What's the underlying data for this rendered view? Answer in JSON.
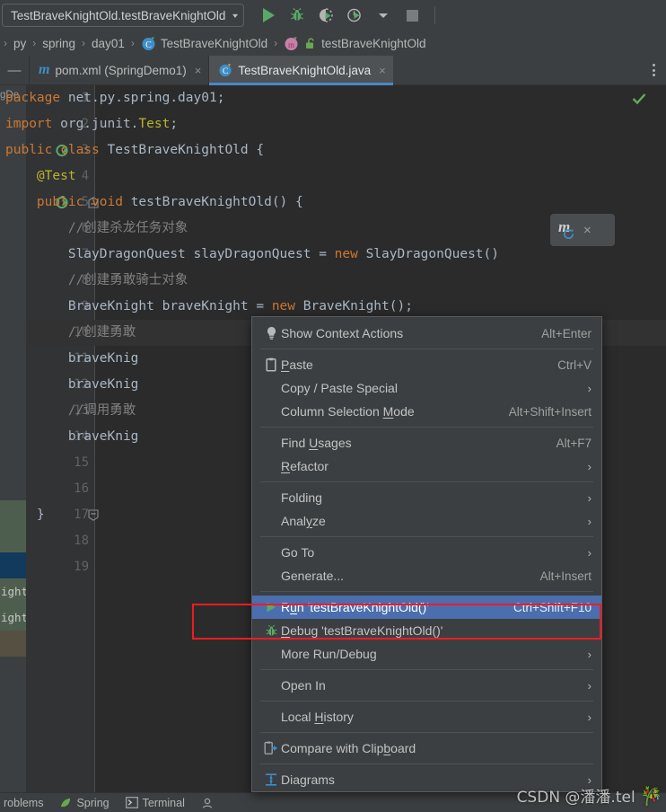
{
  "toolbar": {
    "run_config": "TestBraveKnightOld.testBraveKnightOld",
    "caret": "▾",
    "buttons": [
      {
        "name": "run-button",
        "label": "Run"
      },
      {
        "name": "debug-button",
        "label": "Debug"
      },
      {
        "name": "run-with-coverage-button",
        "label": "Run with Coverage"
      },
      {
        "name": "profiler-button",
        "label": "Profiler"
      },
      {
        "name": "profiler-dropdown",
        "label": "Profiler options"
      },
      {
        "name": "stop-button",
        "label": "Stop"
      }
    ]
  },
  "breadcrumb": {
    "separator": "›",
    "items": [
      {
        "label": "",
        "icon": "folder-icon"
      },
      {
        "label": "py",
        "icon": ""
      },
      {
        "label": "spring",
        "icon": ""
      },
      {
        "label": "day01",
        "icon": ""
      },
      {
        "label": "TestBraveKnightOld",
        "icon": "class-icon"
      },
      {
        "label": "testBraveKnightOld",
        "icon": "method-icon"
      }
    ]
  },
  "tabs": {
    "collapse_label": "—",
    "items": [
      {
        "label": "pom.xml (SpringDemo1)",
        "icon": "maven-icon",
        "active": false,
        "close": "×"
      },
      {
        "label": "TestBraveKnightOld.java",
        "icon": "java-class-icon",
        "active": true,
        "close": "×"
      }
    ],
    "overflow_label": "Tab options"
  },
  "editor": {
    "inspection_status": "✔",
    "maven_reload": {
      "label": "m",
      "close": "×"
    },
    "lines": [
      {
        "no": "1",
        "gutter": "",
        "fold": "",
        "tokens": [
          {
            "t": "package ",
            "c": "kw"
          },
          {
            "t": "net.py.spring.day01;",
            "c": "txt"
          }
        ]
      },
      {
        "no": "2",
        "gutter": "",
        "fold": "",
        "tokens": [
          {
            "t": "import ",
            "c": "kw"
          },
          {
            "t": "org.junit.",
            "c": "txt"
          },
          {
            "t": "Test",
            "c": "ann"
          },
          {
            "t": ";",
            "c": "txt"
          }
        ]
      },
      {
        "no": "3",
        "gutter": "run",
        "fold": "",
        "tokens": [
          {
            "t": "public class ",
            "c": "kw"
          },
          {
            "t": "TestBraveKnightOld {",
            "c": "txt"
          }
        ]
      },
      {
        "no": "4",
        "gutter": "",
        "fold": "",
        "tokens": [
          {
            "t": "    @Test",
            "c": "ann"
          }
        ]
      },
      {
        "no": "5",
        "gutter": "run",
        "fold": "minus",
        "tokens": [
          {
            "t": "    ",
            "c": "txt"
          },
          {
            "t": "public void ",
            "c": "kw"
          },
          {
            "t": "testBraveKnightOld() {",
            "c": "txt"
          }
        ]
      },
      {
        "no": "6",
        "gutter": "",
        "fold": "",
        "tokens": [
          {
            "t": "        //创建杀龙任务对象",
            "c": "cmt"
          }
        ]
      },
      {
        "no": "7",
        "gutter": "",
        "fold": "",
        "tokens": [
          {
            "t": "        SlayDragonQuest slayDragonQuest = ",
            "c": "txt"
          },
          {
            "t": "new ",
            "c": "kw"
          },
          {
            "t": "SlayDragonQuest()",
            "c": "txt"
          }
        ]
      },
      {
        "no": "8",
        "gutter": "",
        "fold": "",
        "tokens": [
          {
            "t": "        //创建勇敢骑士对象",
            "c": "cmt"
          }
        ]
      },
      {
        "no": "9",
        "gutter": "",
        "fold": "",
        "tokens": [
          {
            "t": "        BraveKnight braveKnight = ",
            "c": "txt"
          },
          {
            "t": "new ",
            "c": "kw"
          },
          {
            "t": "BraveKnight();",
            "c": "txt"
          }
        ]
      },
      {
        "no": "10",
        "gutter": "",
        "fold": "",
        "current": true,
        "tokens": [
          {
            "t": "        //创建勇敢",
            "c": "cmt"
          }
        ]
      },
      {
        "no": "11",
        "gutter": "",
        "fold": "",
        "tokens": [
          {
            "t": "        braveKnig",
            "c": "txt"
          }
        ]
      },
      {
        "no": "12",
        "gutter": "",
        "fold": "",
        "tokens": [
          {
            "t": "        braveKnig",
            "c": "txt"
          }
        ]
      },
      {
        "no": "13",
        "gutter": "",
        "fold": "",
        "tokens": [
          {
            "t": "        //调用勇敢",
            "c": "cmt"
          }
        ]
      },
      {
        "no": "14",
        "gutter": "",
        "fold": "",
        "tokens": [
          {
            "t": "        braveKnig",
            "c": "txt"
          }
        ]
      },
      {
        "no": "15",
        "gutter": "",
        "fold": "",
        "tokens": []
      },
      {
        "no": "16",
        "gutter": "",
        "fold": "",
        "tokens": []
      },
      {
        "no": "17",
        "gutter": "",
        "fold": "end",
        "tokens": [
          {
            "t": "    }",
            "c": "txt"
          }
        ]
      },
      {
        "no": "18",
        "gutter": "",
        "fold": "",
        "tokens": [
          {
            "t": "}",
            "c": "txt"
          }
        ]
      },
      {
        "no": "19",
        "gutter": "",
        "fold": "",
        "tokens": []
      }
    ],
    "popup_fragment_rows": [
      {
        "label": "",
        "style": "pf-grn"
      },
      {
        "label": "",
        "style": "pf-grn"
      },
      {
        "label": "",
        "style": "pf-sel"
      },
      {
        "label": "ight",
        "style": "pf-grn"
      },
      {
        "label": "ight",
        "style": "pf-grn"
      },
      {
        "label": "",
        "style": "pf-brn"
      }
    ],
    "left_strip_label": "gDe"
  },
  "context_menu": {
    "groups": [
      [
        {
          "name": "show-context-actions",
          "icon": "lightbulb-icon",
          "pre": "",
          "u": "",
          "post": "Show Context Actions",
          "accel": "Alt+Enter",
          "arrow": "",
          "selected": false
        }
      ],
      [
        {
          "name": "paste",
          "icon": "clipboard-icon",
          "pre": "",
          "u": "P",
          "post": "aste",
          "accel": "Ctrl+V",
          "arrow": "",
          "selected": false
        },
        {
          "name": "copy-paste-special",
          "icon": "",
          "pre": "Copy / Paste Special",
          "u": "",
          "post": "",
          "accel": "",
          "arrow": "›",
          "selected": false
        },
        {
          "name": "column-selection-mode",
          "icon": "",
          "pre": "Column Selection ",
          "u": "M",
          "post": "ode",
          "accel": "Alt+Shift+Insert",
          "arrow": "",
          "selected": false
        }
      ],
      [
        {
          "name": "find-usages",
          "icon": "",
          "pre": "Find ",
          "u": "U",
          "post": "sages",
          "accel": "Alt+F7",
          "arrow": "",
          "selected": false
        },
        {
          "name": "refactor",
          "icon": "",
          "pre": "",
          "u": "R",
          "post": "efactor",
          "accel": "",
          "arrow": "›",
          "selected": false
        }
      ],
      [
        {
          "name": "folding",
          "icon": "",
          "pre": "Folding",
          "u": "",
          "post": "",
          "accel": "",
          "arrow": "›",
          "selected": false
        },
        {
          "name": "analyze",
          "icon": "",
          "pre": "Anal",
          "u": "y",
          "post": "ze",
          "accel": "",
          "arrow": "›",
          "selected": false
        }
      ],
      [
        {
          "name": "go-to",
          "icon": "",
          "pre": "Go To",
          "u": "",
          "post": "",
          "accel": "",
          "arrow": "›",
          "selected": false
        },
        {
          "name": "generate",
          "icon": "",
          "pre": "Generate...",
          "u": "",
          "post": "",
          "accel": "Alt+Insert",
          "arrow": "",
          "selected": false
        }
      ],
      [
        {
          "name": "run-test",
          "icon": "run-icon",
          "pre": "R",
          "u": "u",
          "post": "n 'testBraveKnightOld()'",
          "accel": "Ctrl+Shift+F10",
          "arrow": "",
          "selected": true
        },
        {
          "name": "debug-test",
          "icon": "debug-icon",
          "pre": "",
          "u": "D",
          "post": "ebug 'testBraveKnightOld()'",
          "accel": "",
          "arrow": "",
          "selected": false
        },
        {
          "name": "more-run-debug",
          "icon": "",
          "pre": "More Run/Debug",
          "u": "",
          "post": "",
          "accel": "",
          "arrow": "›",
          "selected": false
        }
      ],
      [
        {
          "name": "open-in",
          "icon": "",
          "pre": "Open In",
          "u": "",
          "post": "",
          "accel": "",
          "arrow": "›",
          "selected": false
        }
      ],
      [
        {
          "name": "local-history",
          "icon": "",
          "pre": "Local ",
          "u": "H",
          "post": "istory",
          "accel": "",
          "arrow": "›",
          "selected": false
        }
      ],
      [
        {
          "name": "compare-with-clipboard",
          "icon": "compare-icon",
          "pre": "Compare with Clip",
          "u": "b",
          "post": "oard",
          "accel": "",
          "arrow": "",
          "selected": false
        }
      ],
      [
        {
          "name": "diagrams",
          "icon": "diagram-icon",
          "pre": "Diagrams",
          "u": "",
          "post": "",
          "accel": "",
          "arrow": "›",
          "selected": false
        }
      ]
    ]
  },
  "bottom_bar": {
    "items": [
      {
        "label": "roblems",
        "icon": "problems-icon"
      },
      {
        "label": "Spring",
        "icon": "spring-leaf-icon"
      },
      {
        "label": "Terminal",
        "icon": "terminal-icon"
      },
      {
        "label": "",
        "icon": "profiler-icon"
      }
    ]
  },
  "watermark": {
    "text": "CSDN @潘潘.tel",
    "emoji": "🎋"
  },
  "colors": {
    "accent_blue": "#4b6eaf",
    "tab_underline": "#4a88c7",
    "run_green": "#59a869",
    "highlight_red": "#ed1c24",
    "editor_bg": "#2b2b2b",
    "panel_bg": "#3c3f41"
  }
}
